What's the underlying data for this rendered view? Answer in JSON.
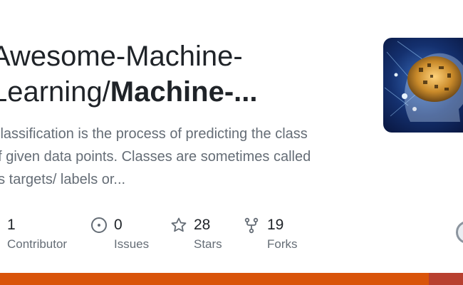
{
  "repo": {
    "title_owner": "Awesome-Machine-",
    "title_line2_prefix": "Learning/",
    "title_repo": "Machine-...",
    "description_lines": [
      "Classification is the process of predicting the class",
      "of given data points. Classes are sometimes called",
      "as targets/ labels or..."
    ]
  },
  "stats": [
    {
      "value": "1",
      "label": "Contributor",
      "icon": "people-icon"
    },
    {
      "value": "0",
      "label": "Issues",
      "icon": "issue-opened-icon"
    },
    {
      "value": "28",
      "label": "Stars",
      "icon": "star-icon"
    },
    {
      "value": "19",
      "label": "Forks",
      "icon": "repo-forked-icon"
    }
  ],
  "colors": {
    "language_bar_primary": "#d9540a",
    "language_bar_secondary": "#b8402f",
    "text_primary": "#1f2328",
    "text_muted": "#656d76"
  }
}
